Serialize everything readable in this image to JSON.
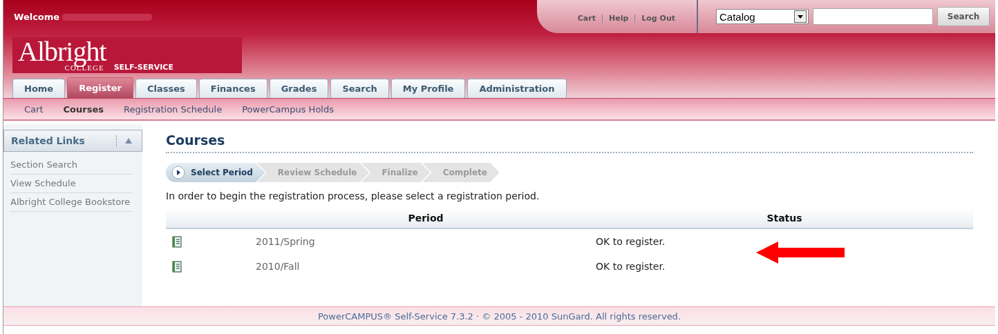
{
  "header": {
    "welcome": "Welcome",
    "top_links": [
      "Cart",
      "Help",
      "Log Out"
    ],
    "search": {
      "scope": "Catalog",
      "button": "Search"
    },
    "logo": {
      "name": "Albright",
      "sub": "COLLEGE",
      "tag": "SELF-SERVICE"
    }
  },
  "tabs": [
    {
      "label": "Home",
      "selected": false
    },
    {
      "label": "Register",
      "selected": true
    },
    {
      "label": "Classes",
      "selected": false
    },
    {
      "label": "Finances",
      "selected": false
    },
    {
      "label": "Grades",
      "selected": false
    },
    {
      "label": "Search",
      "selected": false
    },
    {
      "label": "My Profile",
      "selected": false
    },
    {
      "label": "Administration",
      "selected": false
    }
  ],
  "subnav": [
    {
      "label": "Cart",
      "selected": false
    },
    {
      "label": "Courses",
      "selected": true
    },
    {
      "label": "Registration Schedule",
      "selected": false
    },
    {
      "label": "PowerCampus Holds",
      "selected": false
    }
  ],
  "sidebar": {
    "title": "Related Links",
    "expanded": true,
    "items": [
      "Section Search",
      "View Schedule",
      "Albright College Bookstore"
    ]
  },
  "page_title": "Courses",
  "steps": [
    {
      "label": "Select Period",
      "selected": true
    },
    {
      "label": "Review Schedule",
      "selected": false
    },
    {
      "label": "Finalize",
      "selected": false
    },
    {
      "label": "Complete",
      "selected": false
    }
  ],
  "instructions": "In order to begin the registration process, please select a registration period.",
  "table": {
    "columns": [
      "Period",
      "Status"
    ],
    "rows": [
      {
        "period": "2011/Spring",
        "status": "OK to register."
      },
      {
        "period": "2010/Fall",
        "status": "OK to register."
      }
    ]
  },
  "footer": "PowerCAMPUS® Self-Service 7.3.2 · © 2005 - 2010 SunGard. All rights reserved."
}
